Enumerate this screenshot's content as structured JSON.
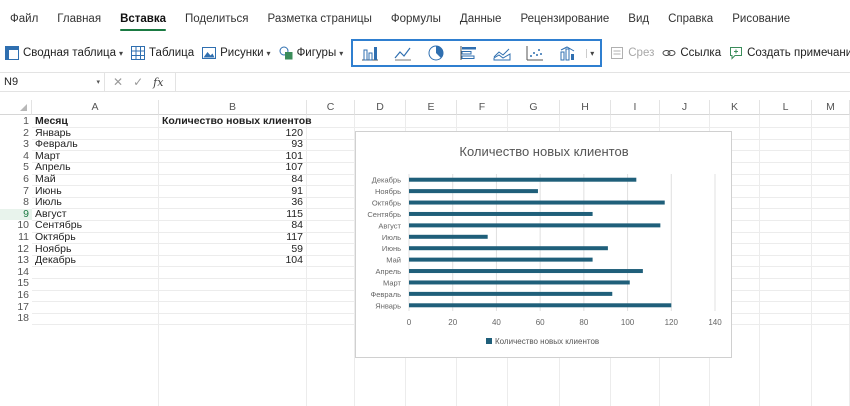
{
  "menu": {
    "tabs": [
      "Файл",
      "Главная",
      "Вставка",
      "Поделиться",
      "Разметка страницы",
      "Формулы",
      "Данные",
      "Рецензирование",
      "Вид",
      "Справка",
      "Рисование"
    ],
    "active_index": 2
  },
  "ribbon": {
    "pivot_label": "Сводная таблица",
    "table_label": "Таблица",
    "pictures_label": "Рисунки",
    "shapes_label": "Фигуры",
    "slicer_label": "Срез",
    "link_label": "Ссылка",
    "comment_label": "Создать примечание",
    "chart_icons": [
      "column-chart-icon",
      "line-chart-icon",
      "pie-chart-icon",
      "bar-chart-icon",
      "area-chart-icon",
      "scatter-chart-icon",
      "combo-chart-icon"
    ]
  },
  "formula_bar": {
    "name_box": "N9",
    "fx": "fx",
    "value": ""
  },
  "sheet": {
    "columns": [
      "A",
      "B",
      "C",
      "D",
      "E",
      "F",
      "G",
      "H",
      "I",
      "J",
      "K",
      "L",
      "M"
    ],
    "row_numbers": [
      "1",
      "2",
      "3",
      "4",
      "5",
      "6",
      "7",
      "8",
      "9",
      "10",
      "11",
      "12",
      "13",
      "14",
      "15",
      "16",
      "17",
      "18"
    ],
    "header": [
      "Месяц",
      "Количество новых клиентов"
    ],
    "rows": [
      [
        "Январь",
        "120"
      ],
      [
        "Февраль",
        "93"
      ],
      [
        "Март",
        "101"
      ],
      [
        "Апрель",
        "107"
      ],
      [
        "Май",
        "84"
      ],
      [
        "Июнь",
        "91"
      ],
      [
        "Июль",
        "36"
      ],
      [
        "Август",
        "115"
      ],
      [
        "Сентябрь",
        "84"
      ],
      [
        "Октябрь",
        "117"
      ],
      [
        "Ноябрь",
        "59"
      ],
      [
        "Декабрь",
        "104"
      ]
    ],
    "selected_row": "9"
  },
  "chart_data": {
    "type": "bar",
    "orientation": "horizontal",
    "title": "Количество новых клиентов",
    "categories": [
      "Январь",
      "Февраль",
      "Март",
      "Апрель",
      "Май",
      "Июнь",
      "Июль",
      "Август",
      "Сентябрь",
      "Октябрь",
      "Ноябрь",
      "Декабрь"
    ],
    "series": [
      {
        "name": "Количество новых клиентов",
        "values": [
          120,
          93,
          101,
          107,
          84,
          91,
          36,
          115,
          84,
          117,
          59,
          104
        ],
        "color": "#1f5f7a"
      }
    ],
    "xlim": [
      0,
      140
    ],
    "xticks": [
      "0",
      "20",
      "40",
      "60",
      "80",
      "100",
      "120",
      "140"
    ],
    "grid": true,
    "legend": "bottom"
  },
  "colors": {
    "accent": "#1a7a42",
    "selection": "#2f7fd0",
    "bar": "#1f5f7a"
  }
}
